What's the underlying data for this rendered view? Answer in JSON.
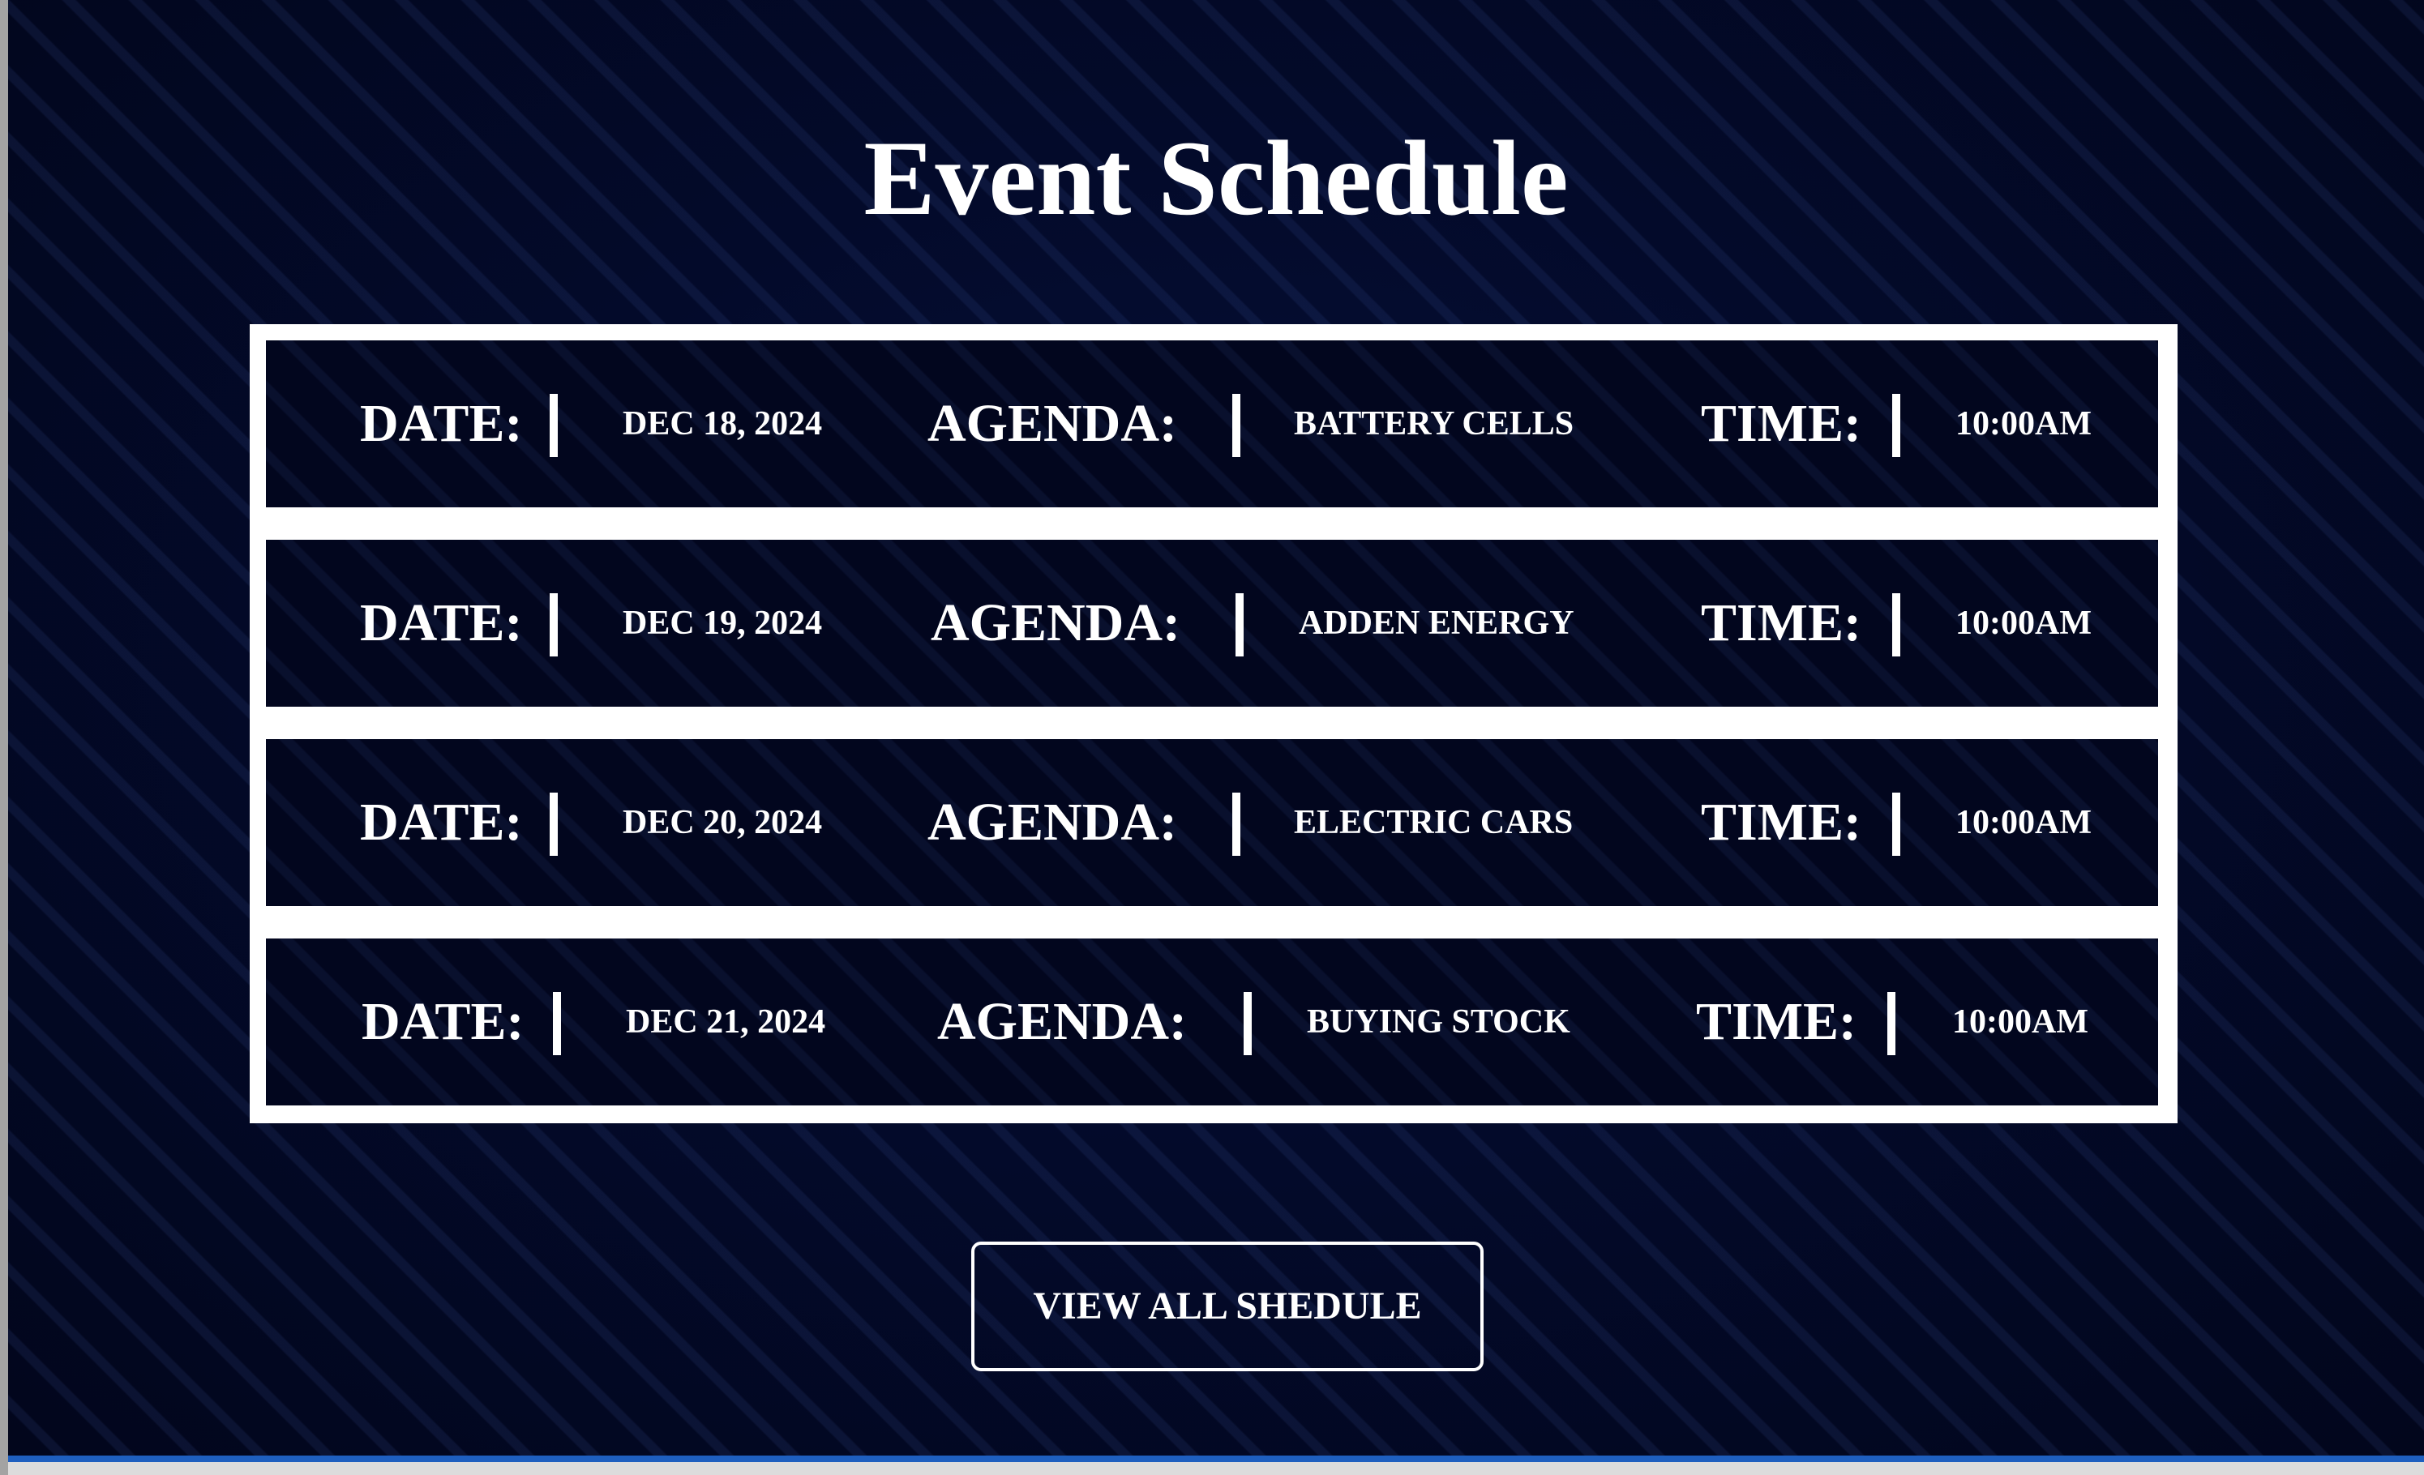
{
  "page": {
    "title": "Event Schedule"
  },
  "labels": {
    "date": "DATE:",
    "agenda": "AGENDA:",
    "time": "TIME:"
  },
  "schedule": [
    {
      "date": "DEC 18, 2024",
      "agenda": "BATTERY CELLS",
      "time": "10:00AM"
    },
    {
      "date": "DEC 19, 2024",
      "agenda": "ADDEN ENERGY",
      "time": "10:00AM"
    },
    {
      "date": "DEC 20, 2024",
      "agenda": "ELECTRIC CARS",
      "time": "10:00AM"
    },
    {
      "date": "DEC 21, 2024",
      "agenda": "BUYING STOCK",
      "time": "10:00AM"
    }
  ],
  "cta": {
    "label": "VIEW ALL SHEDULE"
  },
  "colors": {
    "background": "#030a2a",
    "text": "#ffffff",
    "frame": "#ffffff",
    "row_background": "#02061e"
  }
}
